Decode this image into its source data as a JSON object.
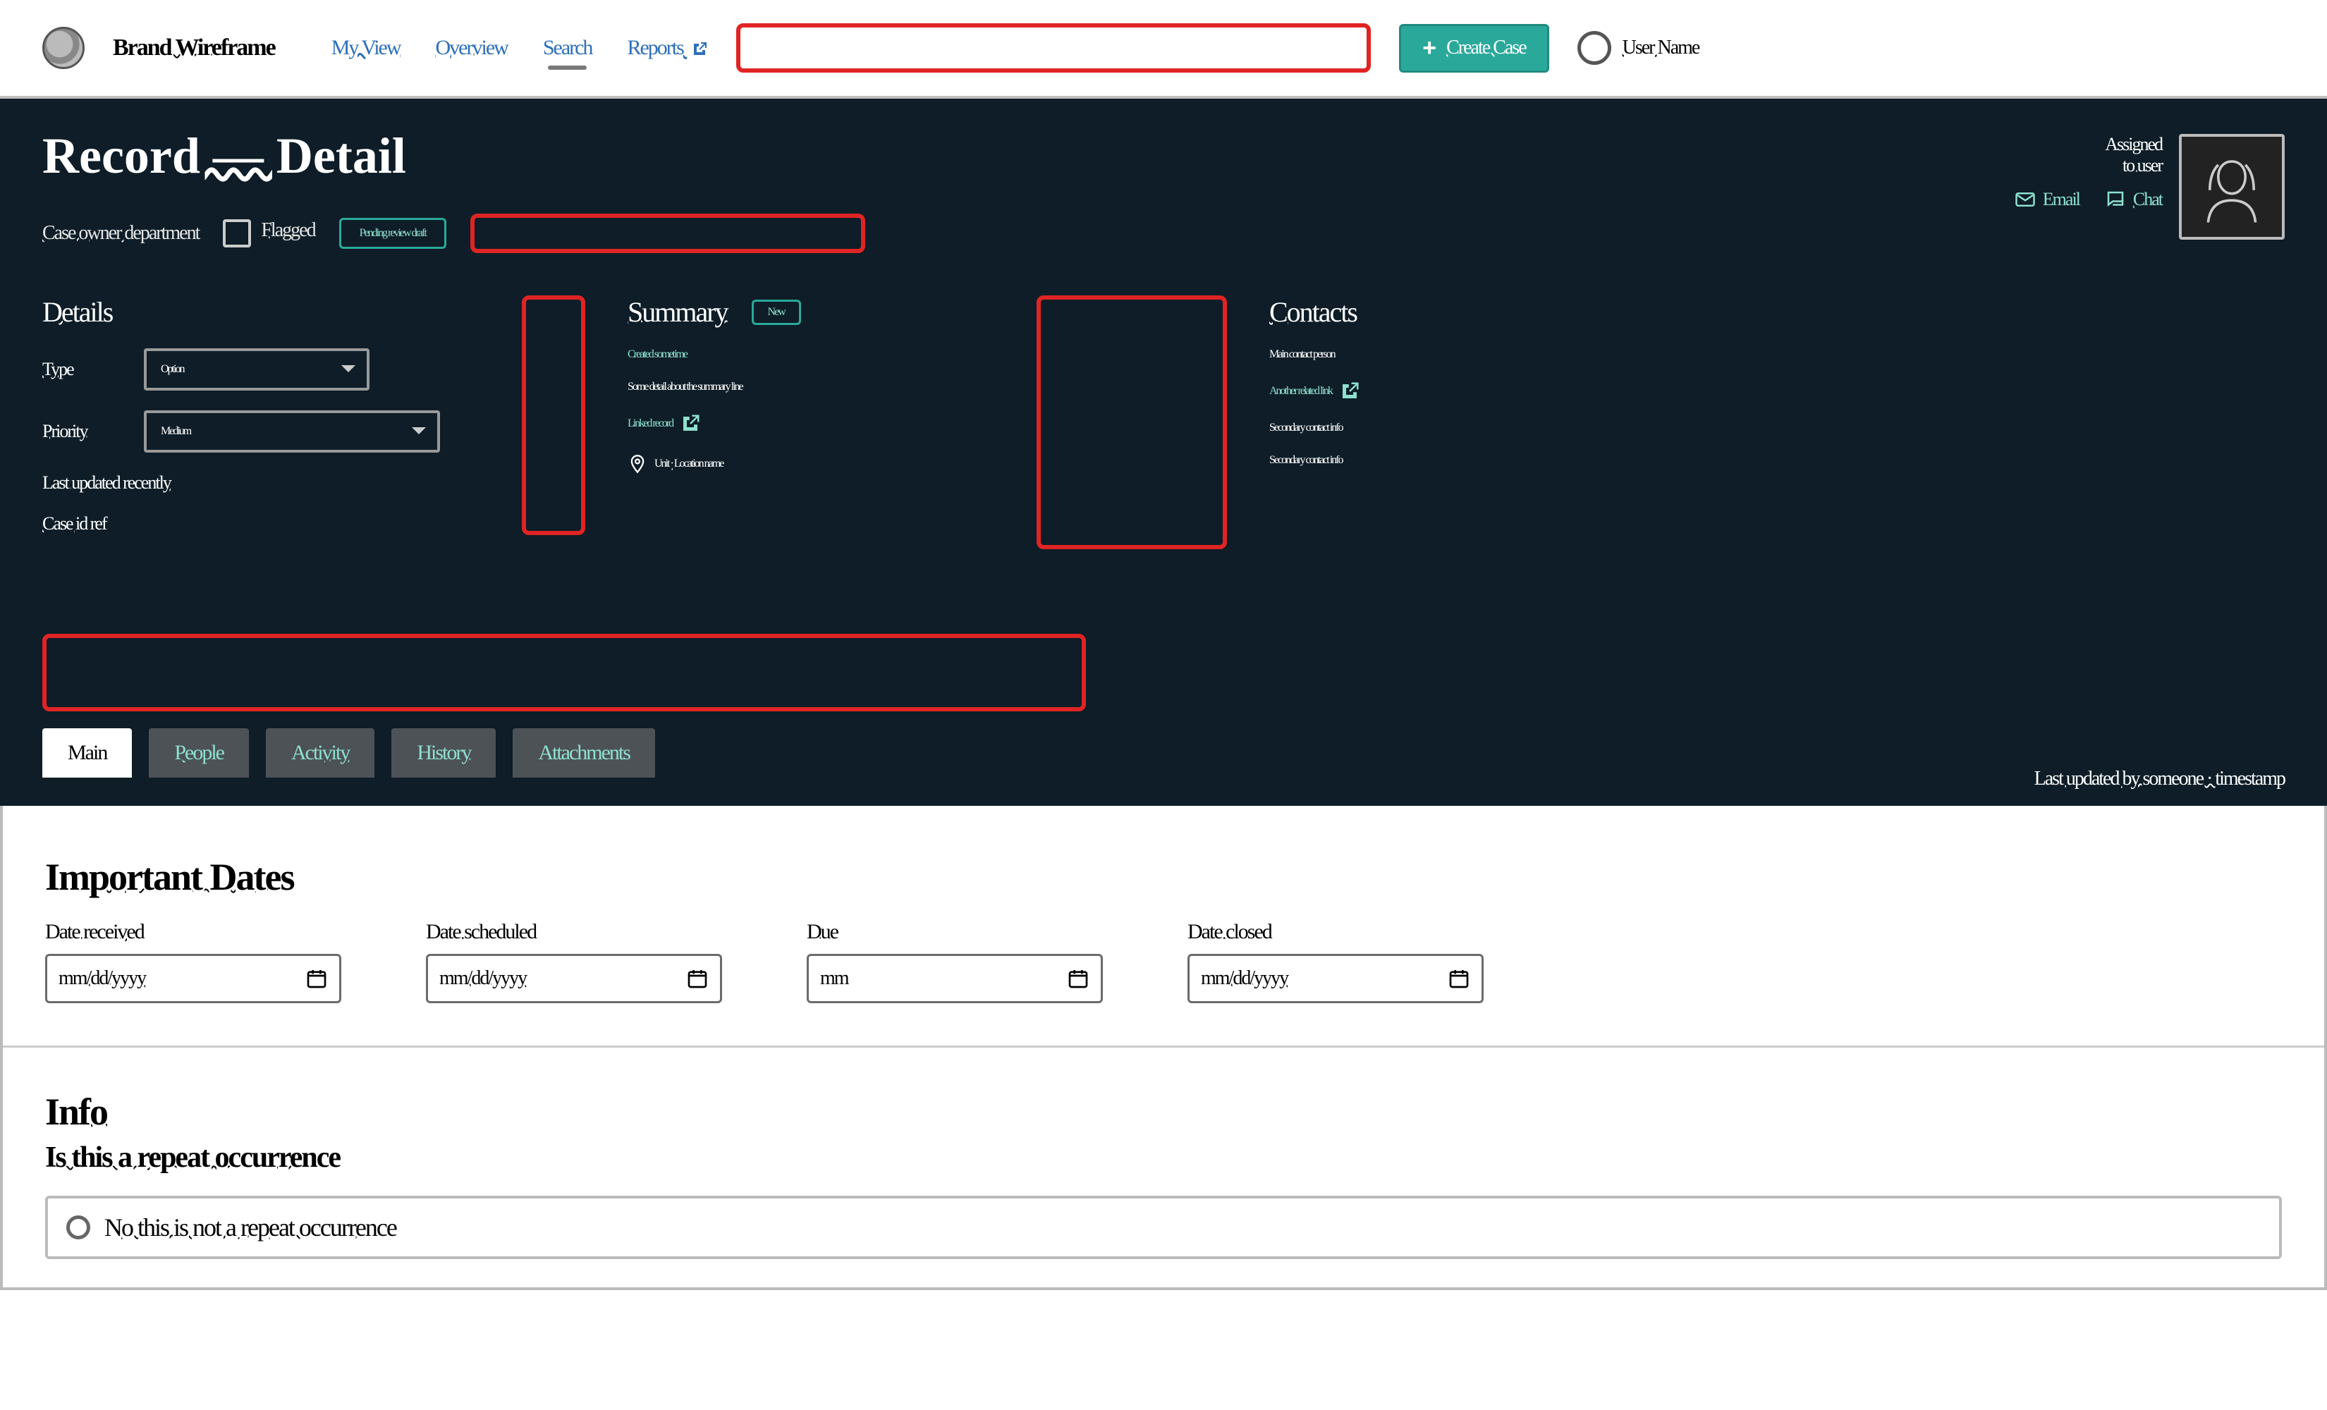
{
  "colors": {
    "accent": "#2aa99a",
    "danger": "#e02424",
    "dark_panel": "#0e1d27",
    "link": "#2d6fb8"
  },
  "topnav": {
    "brand": "Brand Wireframe",
    "links": [
      {
        "label": "My View"
      },
      {
        "label": "Overview"
      },
      {
        "label": "Search",
        "active": true
      },
      {
        "label": "Reports",
        "external": true
      }
    ],
    "search_placeholder": "",
    "create_button": "Create Case",
    "user_name": "User Name"
  },
  "hero": {
    "title": "Record — Detail",
    "subtitle": "Case owner department",
    "flag_label": "Flagged",
    "status_pill": "Pending review draft",
    "red_pill_value": "",
    "info1": {
      "heading": "Details",
      "fields": [
        {
          "label": "Type",
          "value": "Option"
        },
        {
          "label": "Priority",
          "value": "Medium"
        }
      ],
      "footer1": "Last updated recently",
      "footer2": "Case id ref"
    },
    "info2": {
      "heading": "Summary",
      "small_chip": "New",
      "line1": "Created sometime",
      "line2": "Some detail about the summary line",
      "link_line": "Linked record",
      "pin_line": "Unit · Location name"
    },
    "info3": {
      "heading": "Contacts",
      "line1": "Main contact person",
      "link_line": "Another related link",
      "line2": "Secondary contact info",
      "line3": "Secondary contact info"
    },
    "big_red_value": "",
    "tabs": [
      {
        "label": "Main",
        "active": true
      },
      {
        "label": "People"
      },
      {
        "label": "Activity"
      },
      {
        "label": "History"
      },
      {
        "label": "Attachments"
      }
    ],
    "footer_text": "Last updated by someone · timestamp"
  },
  "assigned": {
    "line1": "Assigned",
    "line2": "to user",
    "email_label": "Email",
    "chat_label": "Chat"
  },
  "dates": {
    "section_title": "Important Dates",
    "fields": [
      {
        "label": "Date received",
        "value": "mm/dd/yyyy"
      },
      {
        "label": "Date scheduled",
        "value": "mm/dd/yyyy"
      },
      {
        "label": "Due",
        "value": "mm"
      },
      {
        "label": "Date closed",
        "value": "mm/dd/yyyy"
      }
    ]
  },
  "info_section": {
    "heading": "Info",
    "subheading": "Is this a repeat occurrence",
    "option1": "No this is not a repeat occurrence"
  }
}
